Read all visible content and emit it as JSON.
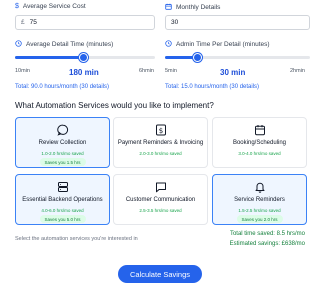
{
  "service_cost": {
    "label": "Average Service Cost",
    "icon": "dollar-icon",
    "prefix": "£",
    "value": "75"
  },
  "monthly_details": {
    "label": "Monthly Details",
    "icon": "calendar-icon",
    "value": "30"
  },
  "detail_time": {
    "label": "Average Detail Time (minutes)",
    "icon": "clock-icon",
    "min_label": "10min",
    "value_label": "180 min",
    "max_label": "6hmin",
    "value": 180,
    "min": 10,
    "max": 360,
    "total": "Total: 90.0 hours/month (30 details)"
  },
  "admin_time": {
    "label": "Admin Time Per Detail (minutes)",
    "icon": "clock-icon",
    "min_label": "5min",
    "value_label": "30 min",
    "max_label": "2hmin",
    "value": 30,
    "min": 5,
    "max": 120,
    "total": "Total: 15.0 hours/month (30 details)"
  },
  "services_title": "What Automation Services would you like to implement?",
  "services": [
    {
      "title": "Review Collection",
      "icon": "chat-bubble-icon",
      "hours": "1.0-2.0 hrs/mo saved",
      "badge": "Saves you 1.5 hrs",
      "selected": true
    },
    {
      "title": "Payment Reminders & Invoicing",
      "icon": "invoice-icon",
      "hours": "2.0-3.0 hrs/mo saved",
      "badge": "",
      "selected": false
    },
    {
      "title": "Booking/Scheduling",
      "icon": "calendar-icon",
      "hours": "3.0-4.0 hrs/mo saved",
      "badge": "",
      "selected": false
    },
    {
      "title": "Essential Backend Operations",
      "icon": "server-icon",
      "hours": "4.0-6.0 hrs/mo saved",
      "badge": "Saves you 5.0 hrs",
      "selected": true
    },
    {
      "title": "Customer Communication",
      "icon": "message-square-icon",
      "hours": "2.5-3.5 hrs/mo saved",
      "badge": "",
      "selected": false
    },
    {
      "title": "Service Reminders",
      "icon": "bell-icon",
      "hours": "1.5-2.5 hrs/mo saved",
      "badge": "Saves you 2.0 hrs",
      "selected": true
    }
  ],
  "hint": "Select the automation services you're interested in",
  "summary": {
    "time_saved": "Total time saved: 8.5 hrs/mo",
    "savings": "Estimated savings: £638/mo"
  },
  "calculate_label": "Calculate Savings",
  "colors": {
    "accent": "#2563eb",
    "selected_bg": "#eff6ff",
    "green": "#16a34a"
  }
}
